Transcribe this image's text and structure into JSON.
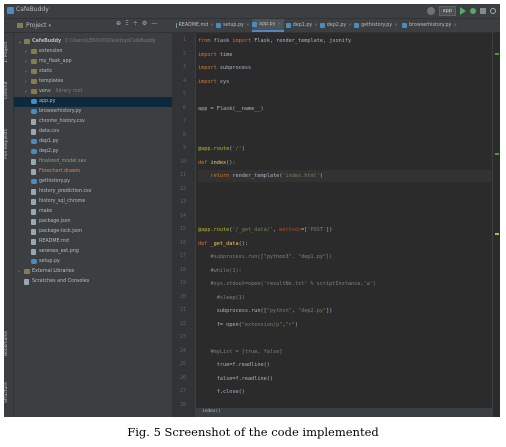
{
  "window": {
    "title": "CafeBuddy",
    "run_config": "app"
  },
  "project_panel": {
    "label": "Project",
    "tool_icons": [
      "⊕",
      "Ξ",
      "÷",
      "⚙",
      "—"
    ],
    "side_labels": [
      "1: Project",
      "Commit",
      "Pull Requests",
      "Bookmarks",
      "Structure"
    ],
    "tree": [
      {
        "depth": 0,
        "arrow": "⌄",
        "icon": "folder",
        "label": "CafeBuddy",
        "hint": "C:\\Users\\LENOVO\\Desktop\\CafeBuddy"
      },
      {
        "depth": 1,
        "arrow": "›",
        "icon": "folder",
        "label": "extension",
        "hint": ""
      },
      {
        "depth": 1,
        "arrow": "›",
        "icon": "folder",
        "label": "my_flask_app",
        "hint": ""
      },
      {
        "depth": 1,
        "arrow": "›",
        "icon": "folder",
        "label": "static",
        "hint": ""
      },
      {
        "depth": 1,
        "arrow": "›",
        "icon": "folder",
        "label": "templates",
        "hint": ""
      },
      {
        "depth": 1,
        "arrow": "›",
        "icon": "folder",
        "label": "venv",
        "hint": "library root"
      },
      {
        "depth": 1,
        "arrow": "",
        "icon": "py",
        "label": "app.py",
        "hint": ""
      },
      {
        "depth": 1,
        "arrow": "",
        "icon": "py",
        "label": "browserhistory.py",
        "hint": ""
      },
      {
        "depth": 1,
        "arrow": "",
        "icon": "file",
        "label": "chrome_history.csv",
        "hint": ""
      },
      {
        "depth": 1,
        "arrow": "",
        "icon": "file",
        "label": "data.csv",
        "hint": ""
      },
      {
        "depth": 1,
        "arrow": "",
        "icon": "py",
        "label": "dep1.py",
        "hint": ""
      },
      {
        "depth": 1,
        "arrow": "",
        "icon": "py",
        "label": "dep2.py",
        "hint": ""
      },
      {
        "depth": 1,
        "arrow": "",
        "icon": "file",
        "label": "finalized_model.sav",
        "hint": ""
      },
      {
        "depth": 1,
        "arrow": "",
        "icon": "file",
        "label": "Flowchart.drawio",
        "hint": ""
      },
      {
        "depth": 1,
        "arrow": "",
        "icon": "py",
        "label": "gethistory.py",
        "hint": ""
      },
      {
        "depth": 1,
        "arrow": "",
        "icon": "file",
        "label": "history_prediction.csv",
        "hint": ""
      },
      {
        "depth": 1,
        "arrow": "",
        "icon": "file",
        "label": "history_sql_chrome",
        "hint": ""
      },
      {
        "depth": 1,
        "arrow": "",
        "icon": "file",
        "label": "make",
        "hint": ""
      },
      {
        "depth": 1,
        "arrow": "",
        "icon": "file",
        "label": "package.json",
        "hint": ""
      },
      {
        "depth": 1,
        "arrow": "",
        "icon": "file",
        "label": "package-lock.json",
        "hint": ""
      },
      {
        "depth": 1,
        "arrow": "",
        "icon": "file",
        "label": "README.md",
        "hint": ""
      },
      {
        "depth": 1,
        "arrow": "",
        "icon": "file",
        "label": "serenea_ext.png",
        "hint": ""
      },
      {
        "depth": 1,
        "arrow": "",
        "icon": "py",
        "label": "setup.py",
        "hint": ""
      },
      {
        "depth": 0,
        "arrow": "›",
        "icon": "folder",
        "label": "External Libraries",
        "hint": ""
      },
      {
        "depth": 0,
        "arrow": "",
        "icon": "file",
        "label": "Scratches and Consoles",
        "hint": ""
      }
    ]
  },
  "tabs": [
    {
      "label": "README.md",
      "active": false
    },
    {
      "label": "setup.py",
      "active": false
    },
    {
      "label": "app.py",
      "active": true
    },
    {
      "label": "dep1.py",
      "active": false
    },
    {
      "label": "dep2.py",
      "active": false
    },
    {
      "label": "gethistory.py",
      "active": false
    },
    {
      "label": "browserhistory.py",
      "active": false
    }
  ],
  "editor": {
    "line_numbers": [
      "1",
      "2",
      "3",
      "4",
      "5",
      "6",
      "7",
      "8",
      "9",
      "10",
      "11",
      "12",
      "13",
      "14",
      "15",
      "16",
      "17",
      "18",
      "19",
      "20",
      "21",
      "22",
      "23",
      "24",
      "25",
      "26",
      "27",
      "28"
    ],
    "lines": [
      "from flask import Flask, render_template, jsonify",
      "import time",
      "import subprocess",
      "import sys",
      "",
      "app = Flask(__name__)",
      "",
      "",
      "@app.route('/')",
      "def index():",
      "    return render_template('index.html')",
      "",
      "",
      "",
      "@app.route('/_get_data/', methods=['POST'])",
      "def _get_data():",
      "    #subprocess.run([\"python3\", \"dep1.py\"])",
      "    #while(1):",
      "    #sys.stdout=open('resultNo.txt' % scriptInstance,'a')",
      "      #sleep(1)",
      "      subprocess.run([\"python\", \"dep2.py\"])",
      "      f= open(\"extension/p\",\"r\")",
      "",
      "    #myList = [true, false]",
      "      true=f.readline()",
      "      false=f.readline()",
      "      f.close()",
      ""
    ],
    "bottom_crumb": "index()"
  },
  "caption": "Fig. 5 Screenshot of the code implemented",
  "colors": {
    "background": "#2b2b2b",
    "panel": "#3c3f41",
    "keyword": "#cc7832",
    "string": "#6a8759",
    "decorator": "#bbb529",
    "comment": "#808080"
  }
}
